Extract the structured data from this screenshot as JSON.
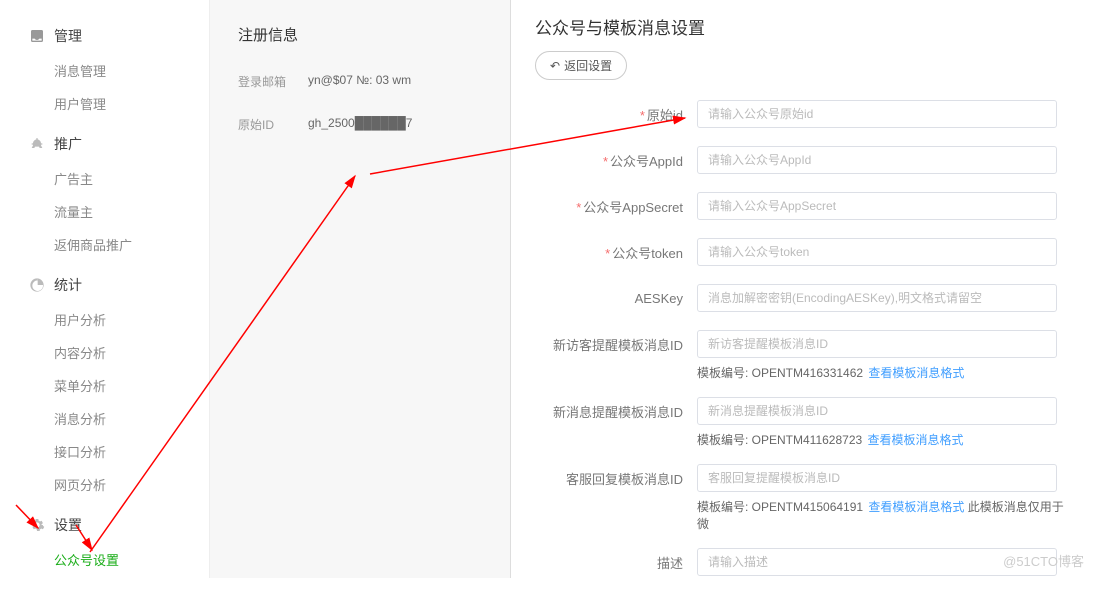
{
  "sidebar": {
    "sections": [
      {
        "title": "管理",
        "icon": "inbox",
        "items": [
          "消息管理",
          "用户管理"
        ]
      },
      {
        "title": "推广",
        "icon": "bullhorn",
        "items": [
          "广告主",
          "流量主",
          "返佣商品推广"
        ]
      },
      {
        "title": "统计",
        "icon": "pie",
        "items": [
          "用户分析",
          "内容分析",
          "菜单分析",
          "消息分析",
          "接口分析",
          "网页分析"
        ]
      },
      {
        "title": "设置",
        "icon": "gear",
        "items": [
          "公众号设置"
        ],
        "activeIndex": 0
      }
    ]
  },
  "middle": {
    "title": "注册信息",
    "rows": [
      {
        "label": "登录邮箱",
        "value": "yn@$07  №: 03  wm"
      },
      {
        "label": "原始ID",
        "value": "gh_2500██████7"
      }
    ]
  },
  "right": {
    "title": "公众号与模板消息设置",
    "back": "返回设置",
    "fields": {
      "originalId": {
        "label": "原始id",
        "placeholder": "请输入公众号原始id",
        "required": true
      },
      "appId": {
        "label": "公众号AppId",
        "placeholder": "请输入公众号AppId",
        "required": true
      },
      "appSecret": {
        "label": "公众号AppSecret",
        "placeholder": "请输入公众号AppSecret",
        "required": true
      },
      "token": {
        "label": "公众号token",
        "placeholder": "请输入公众号token",
        "required": true
      },
      "aesKey": {
        "label": "AESKey",
        "placeholder": "消息加解密密钥(EncodingAESKey),明文格式请留空"
      },
      "newVisitorTpl": {
        "label": "新访客提醒模板消息ID",
        "placeholder": "新访客提醒模板消息ID",
        "hintPrefix": "模板编号: OPENTM416331462",
        "hintLink": "查看模板消息格式"
      },
      "newMsgTpl": {
        "label": "新消息提醒模板消息ID",
        "placeholder": "新消息提醒模板消息ID",
        "hintPrefix": "模板编号: OPENTM411628723",
        "hintLink": "查看模板消息格式"
      },
      "csReplyTpl": {
        "label": "客服回复模板消息ID",
        "placeholder": "客服回复提醒模板消息ID",
        "hintPrefix": "模板编号: OPENTM415064191",
        "hintLink": "查看模板消息格式",
        "hintExtra": " 此模板消息仅用于微"
      },
      "desc": {
        "label": "描述",
        "placeholder": "请输入描述"
      }
    }
  },
  "watermark": "@51CTO博客"
}
